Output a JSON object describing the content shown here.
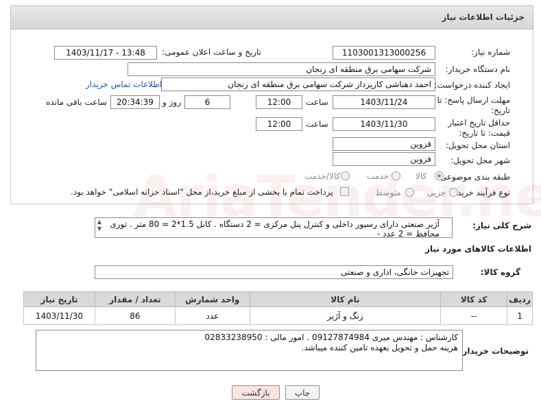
{
  "header": {
    "title": "جزئیات اطلاعات نیاز"
  },
  "form": {
    "need_number_label": "شماره نیاز:",
    "need_number": "1103001313000256",
    "announce_label": "تاریخ و ساعت اعلان عمومی:",
    "announce_value": "1403/11/17 - 13:48",
    "buyer_org_label": "نام دستگاه خریدار:",
    "buyer_org": "شرکت سهامی برق منطقه ای زنجان",
    "requester_label": "ایجاد کننده درخواست:",
    "requester": "احمد دهباشی کارپرداز شرکت سهامی برق منطقه ای زنجان",
    "buyer_contact_link": "اطلاعات تماس خریدار",
    "deadline_label": "مهلت ارسال پاسخ: تا تاریخ:",
    "deadline_date": "1403/11/24",
    "time_label": "ساعت",
    "deadline_time": "12:00",
    "days_value": "6",
    "days_label": "روز و",
    "remaining_time": "20:34:39",
    "remaining_label": "ساعت باقی مانده",
    "validity_label": "حداقل تاریخ اعتبار قیمت: تا تاریخ:",
    "validity_date": "1403/11/30",
    "validity_time": "12:00",
    "province_label": "استان محل تحویل:",
    "province": "قزوین",
    "city_label": "شهر محل تحویل:",
    "city": "قزوین",
    "category_label": "طبقه بندی موضوعی:",
    "category_options": [
      "کالا",
      "خدمت",
      "کالا/خدمت"
    ],
    "process_label": "نوع فرآیند خرید :",
    "process_options": [
      "جزیی",
      "متوسط"
    ],
    "payment_note": "پرداخت تمام یا بخشی از مبلغ خرید،از محل \"اسناد خزانه اسلامی\" خواهد بود."
  },
  "description": {
    "label": "شرح کلی نیاز:",
    "text": "آژیر صنعتی دارای رسیور داخلی و کنترل پنل مرکزی = 2 دستگاه . کابل 1.5*2 = 80 متر . توری محافظ = 2 عدد -"
  },
  "goods_section_title": "اطلاعات کالاهای مورد نیاز",
  "goods_group": {
    "label": "گروه کالا:",
    "value": "تجهیزات خانگی، اداری و صنعتی"
  },
  "table": {
    "headers": [
      "ردیف",
      "کد کالا",
      "نام کالا",
      "واحد شمارش",
      "تعداد / مقدار",
      "تاریخ نیاز"
    ],
    "rows": [
      [
        "1",
        "--",
        "زنگ و آژیر",
        "عدد",
        "86",
        "1403/11/30"
      ]
    ]
  },
  "notes": {
    "label": "توضیحات خریدار:",
    "line1": "کارشناس : مهندس میری 09127874984 . امور مالی : 02833238950",
    "line2": "هزینه حمل و تحویل بعهده تامین کننده میباشد."
  },
  "buttons": {
    "back": "بازگشت",
    "print": "چاپ"
  },
  "watermark": "AriaTender.neT",
  "colors": {
    "link": "#2554a8",
    "back_button_bg": "#fbe3e3"
  }
}
